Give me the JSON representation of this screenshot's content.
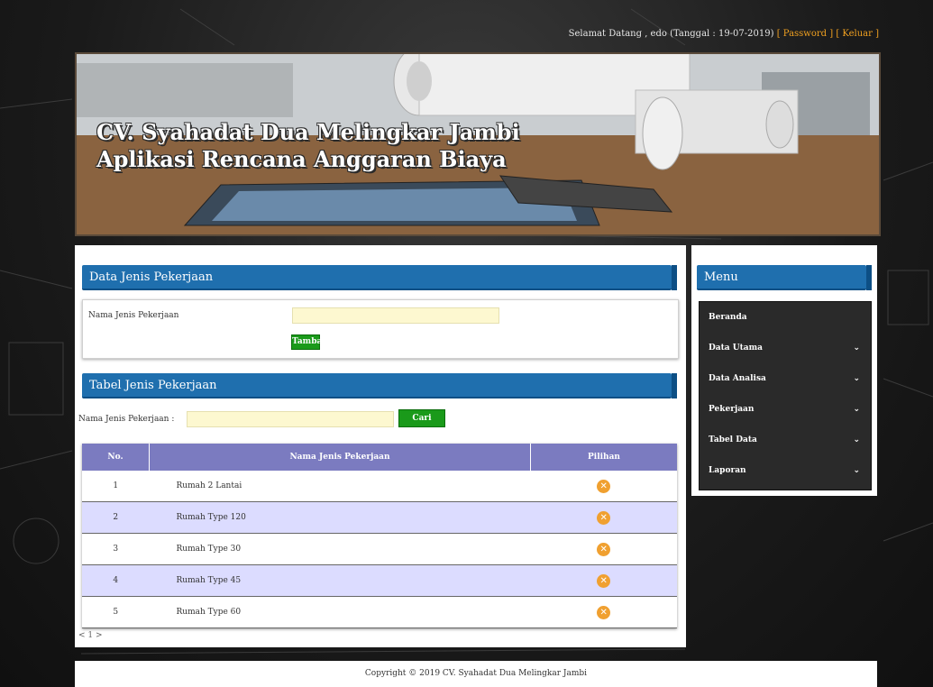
{
  "topbar": {
    "greeting": "Selamat Datang , edo (Tanggal : 19-07-2019)",
    "password_link": "[ Password ]",
    "logout_link": "[ Keluar ]"
  },
  "banner": {
    "line1": "CV. Syahadat Dua Melingkar Jambi",
    "line2": "Aplikasi Rencana Anggaran Biaya"
  },
  "form": {
    "title": "Data Jenis Pekerjaan",
    "field_label": "Nama Jenis Pekerjaan",
    "field_value": "",
    "submit_label": "Tambah"
  },
  "table_section": {
    "title": "Tabel Jenis Pekerjaan",
    "search_label": "Nama Jenis Pekerjaan :",
    "search_value": "",
    "search_button": "Cari",
    "columns": [
      "No.",
      "Nama Jenis Pekerjaan",
      "Pilihan"
    ],
    "rows": [
      {
        "no": "1",
        "name": "Rumah 2 Lantai"
      },
      {
        "no": "2",
        "name": "Rumah Type 120"
      },
      {
        "no": "3",
        "name": "Rumah Type 30"
      },
      {
        "no": "4",
        "name": "Rumah Type 45"
      },
      {
        "no": "5",
        "name": "Rumah Type 60"
      }
    ],
    "pagination": "< 1 >",
    "delete_icon": "close-circle-icon"
  },
  "menu": {
    "title": "Menu",
    "items": [
      {
        "label": "Beranda",
        "has_submenu": false
      },
      {
        "label": "Data Utama",
        "has_submenu": true
      },
      {
        "label": "Data Analisa",
        "has_submenu": true
      },
      {
        "label": "Pekerjaan",
        "has_submenu": true
      },
      {
        "label": "Tabel Data",
        "has_submenu": true
      },
      {
        "label": "Laporan",
        "has_submenu": true
      }
    ]
  },
  "footer": {
    "text": "Copyright © 2019 CV. Syahadat Dua Melingkar Jambi"
  },
  "colors": {
    "header_blue": "#1f6fae",
    "table_header": "#7b7bc0",
    "row_alt": "#dcdcff",
    "button_green": "#1a9a1a",
    "link_orange": "#f0a020",
    "delete_orange": "#f0a030"
  }
}
